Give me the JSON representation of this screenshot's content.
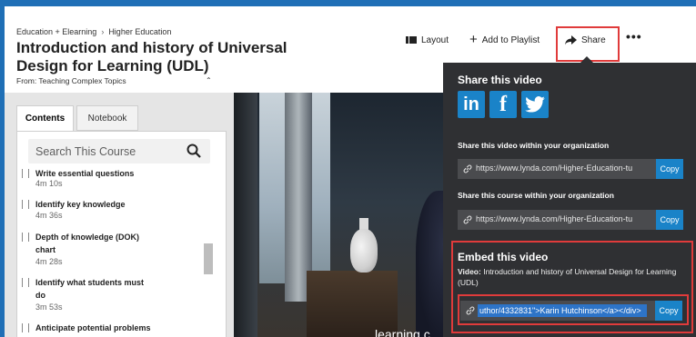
{
  "header": {
    "breadcrumb": [
      "Education + Elearning",
      "Higher Education"
    ],
    "title": "Introduction and history of Universal Design for Learning (UDL)",
    "from": "From: Teaching Complex Topics"
  },
  "toolbar": {
    "layout_label": "Layout",
    "add_playlist_label": "Add to Playlist",
    "share_label": "Share",
    "more_label": "•••"
  },
  "sidebar": {
    "tabs": [
      {
        "label": "Contents",
        "active": true
      },
      {
        "label": "Notebook",
        "active": false
      }
    ],
    "search": {
      "placeholder": "Search This Course",
      "value": ""
    },
    "items": [
      {
        "title": "Write essential questions",
        "duration": "4m 10s"
      },
      {
        "title": "Identify key knowledge",
        "duration": "4m 36s"
      },
      {
        "title": "Depth of knowledge (DOK) chart",
        "duration": "4m 28s"
      },
      {
        "title": "Identify what students must do",
        "duration": "3m 53s"
      },
      {
        "title": "Anticipate potential problems",
        "duration": ""
      }
    ]
  },
  "video": {
    "caption": "learning c"
  },
  "share_popup": {
    "title": "Share this video",
    "social": [
      {
        "name": "linkedin-icon",
        "glyph": "in"
      },
      {
        "name": "facebook-icon",
        "glyph": "f"
      },
      {
        "name": "twitter-icon",
        "glyph": ""
      }
    ],
    "org_video_label": "Share this video within your organization",
    "org_video_url": "https://www.lynda.com/Higher-Education-tu",
    "org_course_label": "Share this course within your organization",
    "org_course_url": "https://www.lynda.com/Higher-Education-tu",
    "copy_label": "Copy",
    "embed": {
      "title": "Embed this video",
      "video_label": "Video:",
      "video_title": "Introduction and history of Universal Design for Learning (UDL)",
      "code": "uthor/4332831\">Karin Hutchinson</a></div>"
    }
  },
  "colors": {
    "brand_blue": "#1f6fb6",
    "popup_bg": "#2f3033",
    "highlight_red": "#e03b3b",
    "copy_blue": "#1a83c8"
  }
}
